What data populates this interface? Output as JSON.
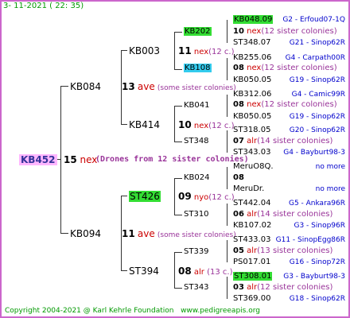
{
  "header": {
    "date": "3-  11-2021  ( 22: 35)"
  },
  "footer": {
    "copyright": "Copyright 2004-2021 @ Karl Kehrle Foundation",
    "url": "www.pedigreeapis.org"
  },
  "root": {
    "name": "KB452",
    "num": "15",
    "race": "nex",
    "note": "(Drones from 12 sister colonies)"
  },
  "gen1": [
    {
      "name": "KB084",
      "num": "13",
      "race": "ave",
      "note": "(some sister colonies)"
    },
    {
      "name": "KB094",
      "num": "11",
      "race": "ave",
      "note": "(some sister colonies)"
    }
  ],
  "gen2": [
    {
      "name": "KB003",
      "num": "11",
      "race": "nex",
      "note": "(12 c.)"
    },
    {
      "name": "KB414",
      "num": "10",
      "race": "nex",
      "note": "(12 c.)"
    },
    {
      "name": "ST426",
      "num": "09",
      "race": "nyo",
      "note": "(12 c.)"
    },
    {
      "name": "ST394",
      "num": "08",
      "race": "alr",
      "note": "(13 c.)"
    }
  ],
  "gen3": [
    {
      "name": "KB202",
      "num": "10",
      "race": "nex",
      "note": "(12 sister colonies)"
    },
    {
      "name": "KB108",
      "num": "08",
      "race": "nex",
      "note": "(12 sister colonies)"
    },
    {
      "name": "KB041",
      "num": "08",
      "race": "nex",
      "note": "(12 sister colonies)"
    },
    {
      "name": "ST348",
      "num": "07",
      "race": "alr",
      "note": "(14 sister colonies)"
    },
    {
      "name": "KB024",
      "num": "08",
      "race": "",
      "note": ""
    },
    {
      "name": "ST310",
      "num": "06",
      "race": "alr",
      "note": "(14 sister colonies)"
    },
    {
      "name": "ST339",
      "num": "05",
      "race": "alr",
      "note": "(13 sister colonies)"
    },
    {
      "name": "ST343",
      "num": "03",
      "race": "alr",
      "note": "(12 sister colonies)"
    }
  ],
  "gen4": [
    {
      "name": "KB048.09",
      "info": "G2 - Erfoud07-1Q"
    },
    {
      "name": "ST348.07",
      "info": "G21 - Sinop62R"
    },
    {
      "name": "KB255.06",
      "info": "G4 - Carpath00R"
    },
    {
      "name": "KB050.05",
      "info": "G19 - Sinop62R"
    },
    {
      "name": "KB312.06",
      "info": "G4 - Camic99R"
    },
    {
      "name": "KB050.05",
      "info": "G19 - Sinop62R"
    },
    {
      "name": "ST318.05",
      "info": "G20 - Sinop62R"
    },
    {
      "name": "ST343.03",
      "info": "G4 - Bayburt98-3"
    },
    {
      "name": "MeruO8Q.",
      "info": "no more"
    },
    {
      "name": "MeruDr.",
      "info": "no more"
    },
    {
      "name": "ST442.04",
      "info": "G5 - Ankara96R"
    },
    {
      "name": "KB107.02",
      "info": "G3 - Sinop96R"
    },
    {
      "name": "ST433.03",
      "info": "G11 - SinopEgg86R"
    },
    {
      "name": "PS017.01",
      "info": "G16 - Sinop72R"
    },
    {
      "name": "ST308.01",
      "info": "G3 - Bayburt98-3"
    },
    {
      "name": "ST369.00",
      "info": "G18 - Sinop62R"
    }
  ]
}
